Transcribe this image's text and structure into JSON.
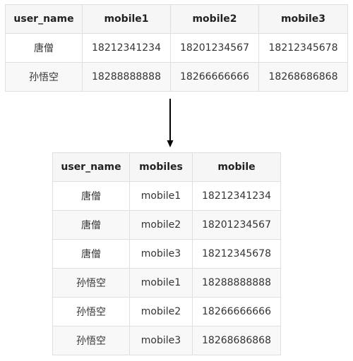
{
  "source_table": {
    "headers": [
      "user_name",
      "mobile1",
      "mobile2",
      "mobile3"
    ],
    "rows": [
      [
        "唐僧",
        "18212341234",
        "18201234567",
        "18212345678"
      ],
      [
        "孙悟空",
        "18288888888",
        "18266666666",
        "18268686868"
      ]
    ]
  },
  "arrow": {
    "icon": "arrow-down-icon"
  },
  "result_table": {
    "headers": [
      "user_name",
      "mobiles",
      "mobile"
    ],
    "rows": [
      [
        "唐僧",
        "mobile1",
        "18212341234"
      ],
      [
        "唐僧",
        "mobile2",
        "18201234567"
      ],
      [
        "唐僧",
        "mobile3",
        "18212345678"
      ],
      [
        "孙悟空",
        "mobile1",
        "18288888888"
      ],
      [
        "孙悟空",
        "mobile2",
        "18266666666"
      ],
      [
        "孙悟空",
        "mobile3",
        "18268686868"
      ]
    ]
  }
}
